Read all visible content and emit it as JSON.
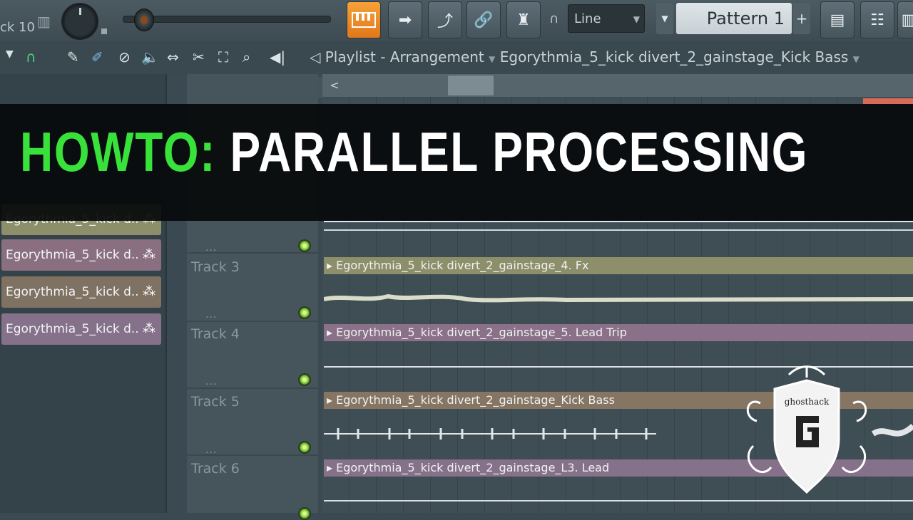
{
  "toolbar": {
    "track_label": "ck 10",
    "line_mode": "Line",
    "pattern": "Pattern 1",
    "add": "+"
  },
  "breadcrumb": {
    "view": "Playlist - Arrangement",
    "separator": "›",
    "pattern": "Egorythmia_5_kick divert_2_gainstage_Kick Bass"
  },
  "clip_list": [
    {
      "label": "Egorythmia_5_kick d..",
      "color": "#8d8f6a"
    },
    {
      "label": "Egorythmia_5_kick d..",
      "color": "#8a6f80"
    },
    {
      "label": "Egorythmia_5_kick d..",
      "color": "#7f7262"
    },
    {
      "label": "Egorythmia_5_kick d..",
      "color": "#86718a"
    }
  ],
  "tracks": [
    {
      "name": "Track 3",
      "clip": "Egorythmia_5_kick divert_2_gainstage_4. Fx",
      "color": "#8d8f6a"
    },
    {
      "name": "Track 4",
      "clip": "Egorythmia_5_kick divert_2_gainstage_5. Lead Trip",
      "color": "#8a7088"
    },
    {
      "name": "Track 5",
      "clip": "Egorythmia_5_kick divert_2_gainstage_Kick Bass",
      "color": "#857562"
    },
    {
      "name": "Track 6",
      "clip": "Egorythmia_5_kick divert_2_gainstage_L3. Lead",
      "color": "#86718a"
    }
  ],
  "banner": {
    "accent": "HOWTO:",
    "title": "PARALLEL PROCESSING",
    "accent_color": "#39e23a"
  },
  "logo": {
    "text": "ghosthack"
  },
  "colors": {
    "active_button": "#f59a33",
    "led": "#79c02a"
  }
}
